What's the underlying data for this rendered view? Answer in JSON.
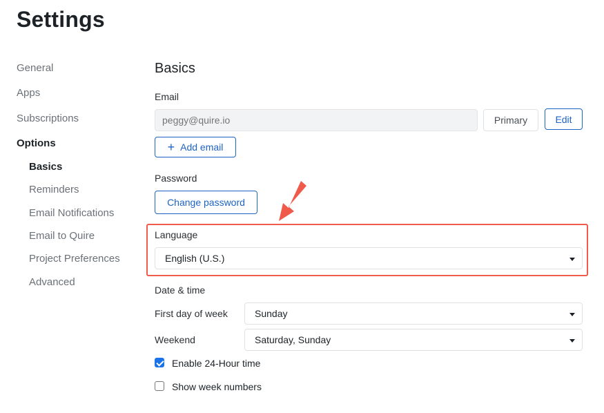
{
  "page": {
    "title": "Settings"
  },
  "sidebar": {
    "items": [
      {
        "label": "General"
      },
      {
        "label": "Apps"
      },
      {
        "label": "Subscriptions"
      },
      {
        "label": "Options"
      }
    ],
    "subitems": [
      {
        "label": "Basics"
      },
      {
        "label": "Reminders"
      },
      {
        "label": "Email Notifications"
      },
      {
        "label": "Email to Quire"
      },
      {
        "label": "Project Preferences"
      },
      {
        "label": "Advanced"
      }
    ],
    "active_item": "Options",
    "active_subitem": "Basics"
  },
  "basics": {
    "title": "Basics",
    "email": {
      "label": "Email",
      "placeholder": "peggy@quire.io",
      "primary_label": "Primary",
      "edit_label": "Edit",
      "add_label": "Add email"
    },
    "password": {
      "label": "Password",
      "change_label": "Change password"
    },
    "language": {
      "label": "Language",
      "value": "English (U.S.)"
    },
    "datetime": {
      "label": "Date & time",
      "first_day_label": "First day of week",
      "first_day_value": "Sunday",
      "weekend_label": "Weekend",
      "weekend_value": "Saturday, Sunday",
      "enable_24h_label": "Enable 24-Hour time",
      "enable_24h_checked": true,
      "week_numbers_label": "Show week numbers",
      "week_numbers_checked": false
    }
  },
  "colors": {
    "accent": "#1d63c4",
    "checkbox": "#1a73e8",
    "highlight": "#f05a4a"
  },
  "icons": {
    "add": "plus-icon",
    "dropdown": "caret-down-icon",
    "annotation": "red-arrow-icon"
  }
}
